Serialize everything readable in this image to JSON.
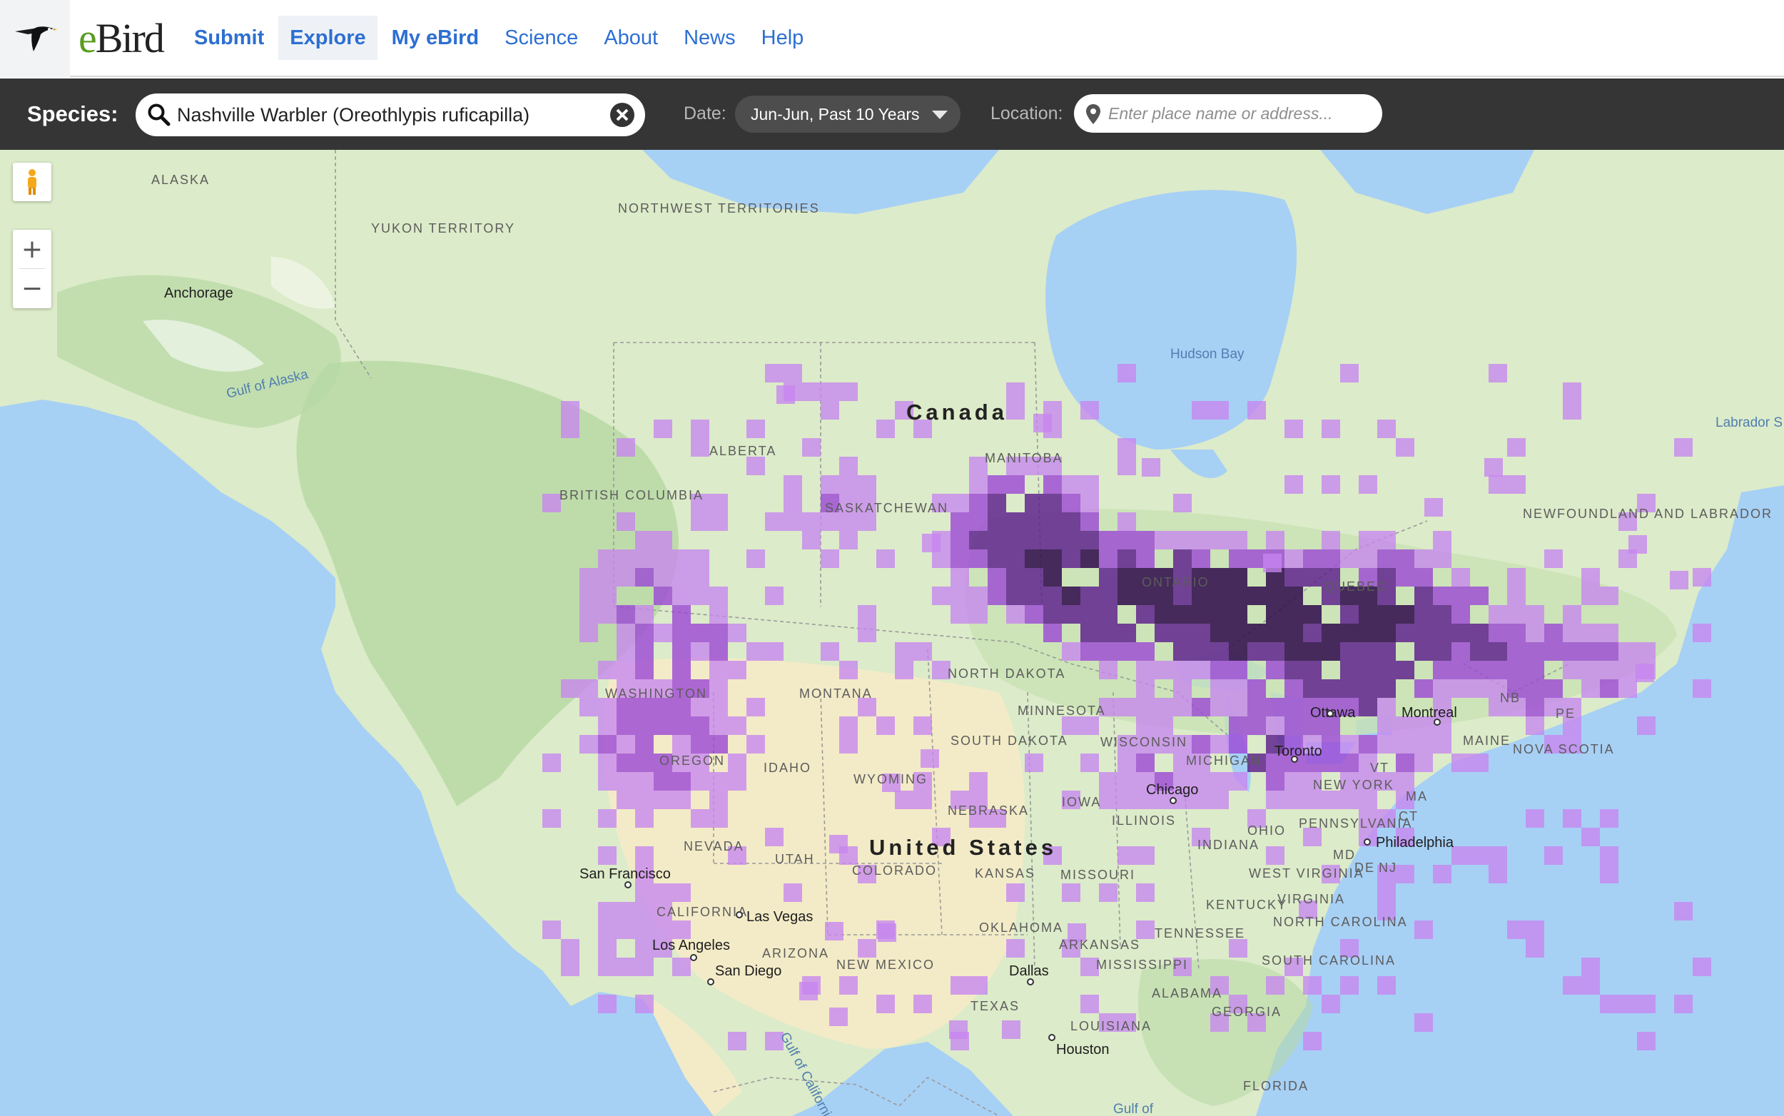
{
  "nav": {
    "logo": "eBird",
    "items": [
      {
        "label": "Submit",
        "bold": true,
        "active": false
      },
      {
        "label": "Explore",
        "bold": true,
        "active": true
      },
      {
        "label": "My eBird",
        "bold": true,
        "active": false
      },
      {
        "label": "Science",
        "bold": false,
        "active": false
      },
      {
        "label": "About",
        "bold": false,
        "active": false
      },
      {
        "label": "News",
        "bold": false,
        "active": false
      },
      {
        "label": "Help",
        "bold": false,
        "active": false
      }
    ],
    "link_color": "#2d6fd2"
  },
  "filters": {
    "species_label": "Species:",
    "species_value": "Nashville Warbler (Oreothlypis ruficapilla)",
    "date_label": "Date:",
    "date_value": "Jun-Jun, Past 10 Years",
    "location_label": "Location:",
    "location_placeholder": "Enter place name or address..."
  },
  "map": {
    "controls": {
      "zoom_in": "+",
      "zoom_out": "−"
    },
    "colors": {
      "water": "#a7d0f5",
      "land": "#dcebc9",
      "forest": "#b7d9a4",
      "desert": "#f3ebc7",
      "range_light": "#c685f0",
      "range_mid": "#9b46d6",
      "range_dark": "#5b1d8c",
      "range_darkest": "#32104f"
    },
    "labels": {
      "countries": [
        "Canada",
        "United States"
      ],
      "regions": [
        "ALASKA",
        "YUKON TERRITORY",
        "NORTHWEST TERRITORIES",
        "ALBERTA",
        "BRITISH COLUMBIA",
        "SASKATCHEWAN",
        "MANITOBA",
        "ONTARIO",
        "QUEBEC",
        "NEWFOUNDLAND AND LABRADOR",
        "WASHINGTON",
        "OREGON",
        "IDAHO",
        "MONTANA",
        "WYOMING",
        "NEVADA",
        "UTAH",
        "COLORADO",
        "CALIFORNIA",
        "ARIZONA",
        "NEW MEXICO",
        "NORTH DAKOTA",
        "SOUTH DAKOTA",
        "NEBRASKA",
        "KANSAS",
        "OKLAHOMA",
        "TEXAS",
        "MINNESOTA",
        "IOWA",
        "MISSOURI",
        "ARKANSAS",
        "LOUISIANA",
        "WISCONSIN",
        "ILLINOIS",
        "MICHIGAN",
        "INDIANA",
        "OHIO",
        "KENTUCKY",
        "TENNESSEE",
        "MISSISSIPPI",
        "ALABAMA",
        "GEORGIA",
        "FLORIDA",
        "SOUTH CAROLINA",
        "NORTH CAROLINA",
        "VIRGINIA",
        "WEST VIRGINIA",
        "PENNSYLVANIA",
        "NEW YORK",
        "MAINE",
        "NOVA SCOTIA",
        "NB",
        "MD",
        "DE",
        "NJ",
        "VT",
        "MA",
        "CT",
        "PE"
      ],
      "cities": [
        "Anchorage",
        "San Francisco",
        "Las Vegas",
        "Los Angeles",
        "San Diego",
        "Dallas",
        "Houston",
        "Chicago",
        "Toronto",
        "Ottawa",
        "Montreal",
        "Philadelphia"
      ],
      "water": [
        "Hudson Bay",
        "Gulf of Alaska",
        "Labrador S",
        "Gulf of",
        "Gulf of California"
      ]
    }
  }
}
